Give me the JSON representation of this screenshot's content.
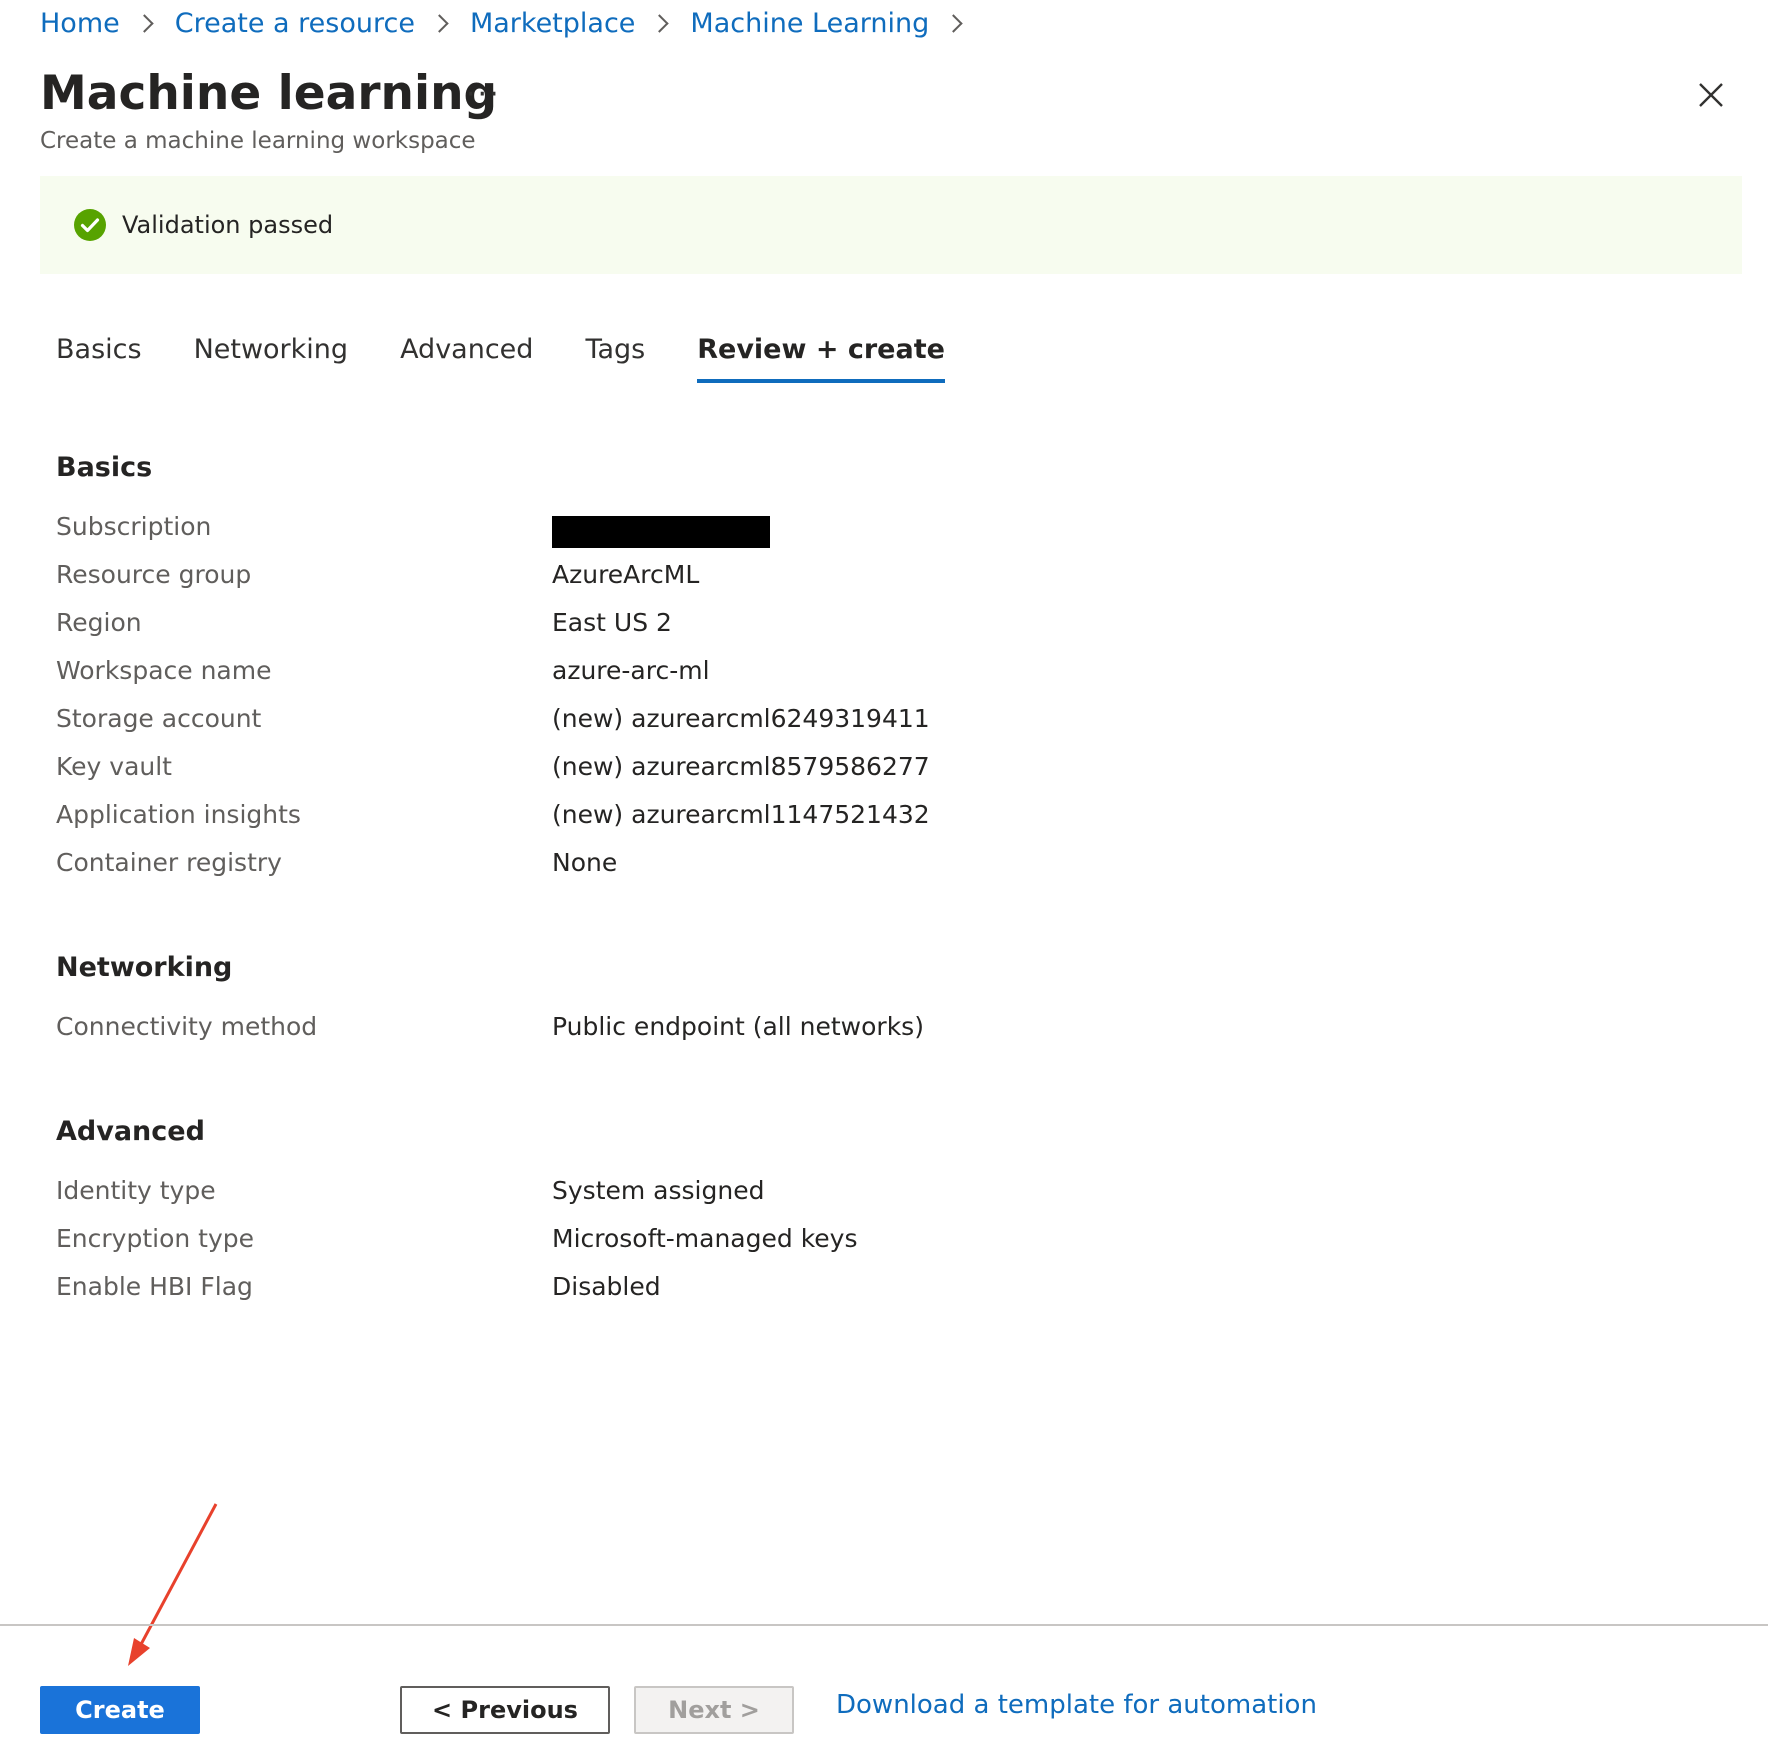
{
  "breadcrumb": [
    "Home",
    "Create a resource",
    "Marketplace",
    "Machine Learning"
  ],
  "header": {
    "title": "Machine learning",
    "subtitle": "Create a machine learning workspace",
    "more_label": "···"
  },
  "validation": {
    "message": "Validation passed",
    "status_color": "#57a300"
  },
  "tabs": [
    {
      "label": "Basics",
      "active": false
    },
    {
      "label": "Networking",
      "active": false
    },
    {
      "label": "Advanced",
      "active": false
    },
    {
      "label": "Tags",
      "active": false
    },
    {
      "label": "Review + create",
      "active": true
    }
  ],
  "sections": {
    "basics": {
      "title": "Basics",
      "rows": [
        {
          "label": "Subscription",
          "value": ""
        },
        {
          "label": "Resource group",
          "value": "AzureArcML"
        },
        {
          "label": "Region",
          "value": "East US 2"
        },
        {
          "label": "Workspace name",
          "value": "azure-arc-ml"
        },
        {
          "label": "Storage account",
          "value": "(new) azurearcml6249319411"
        },
        {
          "label": "Key vault",
          "value": "(new) azurearcml8579586277"
        },
        {
          "label": "Application insights",
          "value": "(new) azurearcml1147521432"
        },
        {
          "label": "Container registry",
          "value": "None"
        }
      ]
    },
    "networking": {
      "title": "Networking",
      "rows": [
        {
          "label": "Connectivity method",
          "value": "Public endpoint (all networks)"
        }
      ]
    },
    "advanced": {
      "title": "Advanced",
      "rows": [
        {
          "label": "Identity type",
          "value": "System assigned"
        },
        {
          "label": "Encryption type",
          "value": "Microsoft-managed keys"
        },
        {
          "label": "Enable HBI Flag",
          "value": "Disabled"
        }
      ]
    }
  },
  "footer": {
    "create_label": "Create",
    "previous_label": "< Previous",
    "next_label": "Next >",
    "download_label": "Download a template for automation"
  },
  "colors": {
    "accent": "#0f6cbd",
    "primary_button": "#1a73d9",
    "annotation_arrow": "#e8412c"
  }
}
